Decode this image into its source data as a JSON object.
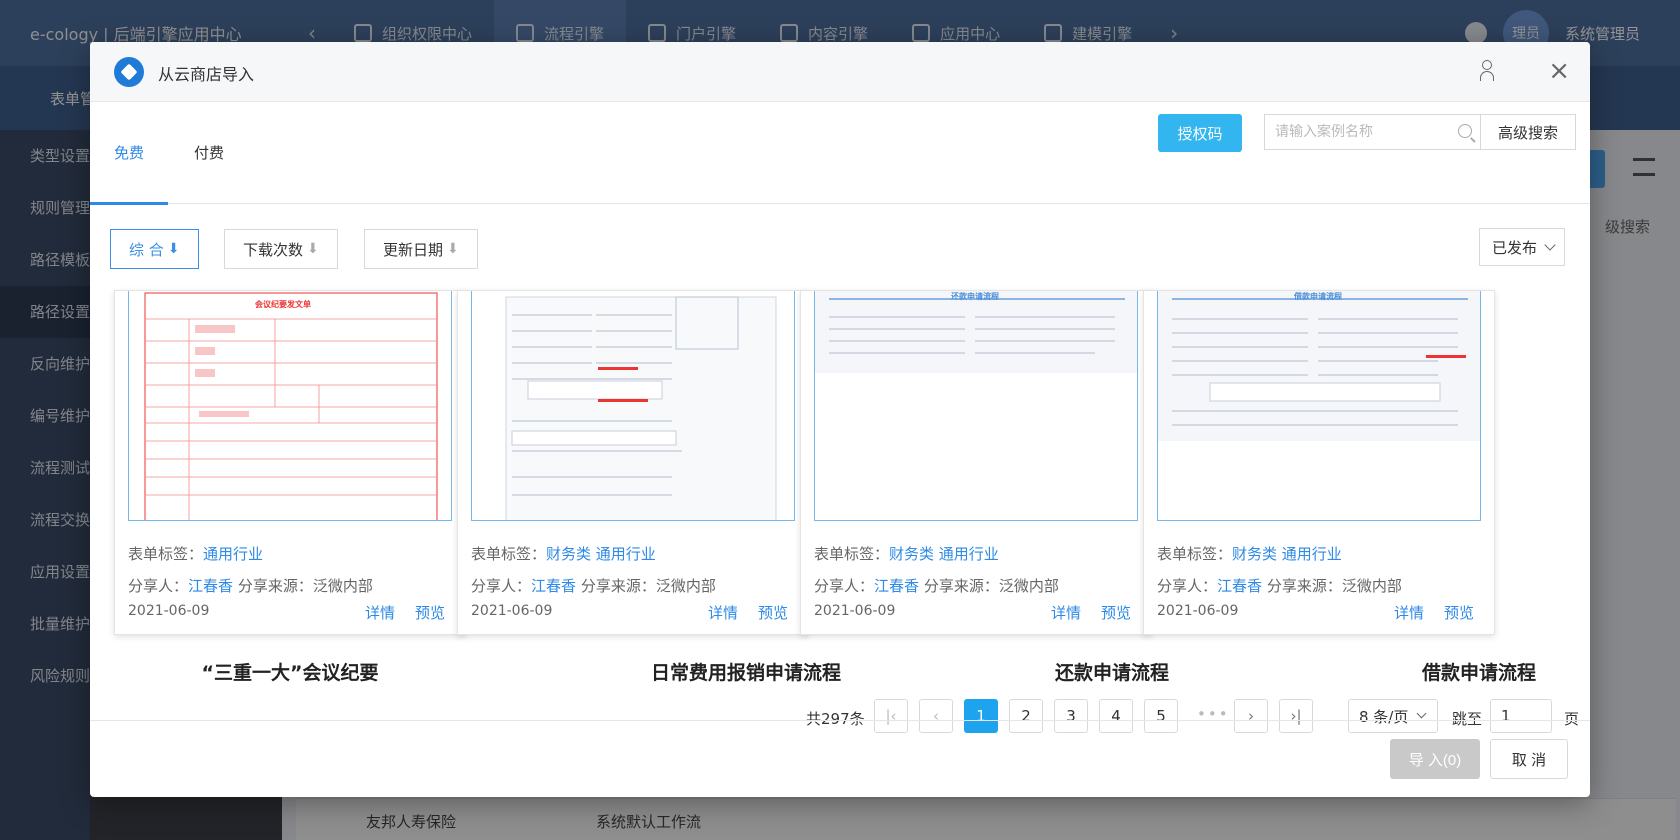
{
  "app": {
    "brand": "e-cology | 后端引擎应用中心",
    "tabs": [
      "组织权限中心",
      "流程引擎",
      "门户引擎",
      "内容引擎",
      "应用中心",
      "建模引擎"
    ],
    "user_avatar": "理员",
    "user_name": "系统管理员",
    "sub_title": "表单管",
    "sidebar": [
      "类型设置",
      "规则管理",
      "路径模板",
      "路径设置",
      "反向维护",
      "编号维护",
      "流程测试",
      "流程交换",
      "应用设置",
      "批量维护",
      "风险规则"
    ],
    "bg_adv_search": "级搜索",
    "bg_row": {
      "left": "友邦人寿保险",
      "mid": "系统默认工作流"
    }
  },
  "modal": {
    "title": "从云商店导入",
    "tabs": {
      "free": "免费",
      "paid": "付费"
    },
    "auth_button": "授权码",
    "search_placeholder": "请输入案例名称",
    "adv_search": "高级搜索",
    "sort": {
      "comprehensive": "综 合",
      "downloads": "下载次数",
      "updated": "更新日期"
    },
    "status": "已发布",
    "labels": {
      "tag_prefix": "表单标签：",
      "sharer_prefix": "分享人：",
      "source_prefix": "分享来源：",
      "detail": "详情",
      "preview": "预览"
    },
    "cards": [
      {
        "tags": "通用行业",
        "sharer": "江春香",
        "source": "泛微内部",
        "date": "2021-06-09",
        "name": "“三重一大”会议纪要",
        "thumb_title": "会议纪要发文单"
      },
      {
        "tags": "财务类 通用行业",
        "sharer": "江春香",
        "source": "泛微内部",
        "date": "2021-06-09",
        "name": "日常费用报销申请流程",
        "thumb_title": ""
      },
      {
        "tags": "财务类 通用行业",
        "sharer": "江春香",
        "source": "泛微内部",
        "date": "2021-06-09",
        "name": "还款申请流程",
        "thumb_title": "还款申请流程"
      },
      {
        "tags": "财务类 通用行业",
        "sharer": "江春香",
        "source": "泛微内部",
        "date": "2021-06-09",
        "name": "借款申请流程",
        "thumb_title": "借款申请流程"
      }
    ],
    "pager": {
      "total": "共297条",
      "pages": [
        "1",
        "2",
        "3",
        "4",
        "5"
      ],
      "current": "1",
      "ellipsis": "•••",
      "page_size": "8 条/页",
      "jump_label": "跳至",
      "jump_value": "1",
      "page_suffix": "页"
    },
    "footer": {
      "import": "导 入(0)",
      "cancel": "取 消"
    }
  }
}
